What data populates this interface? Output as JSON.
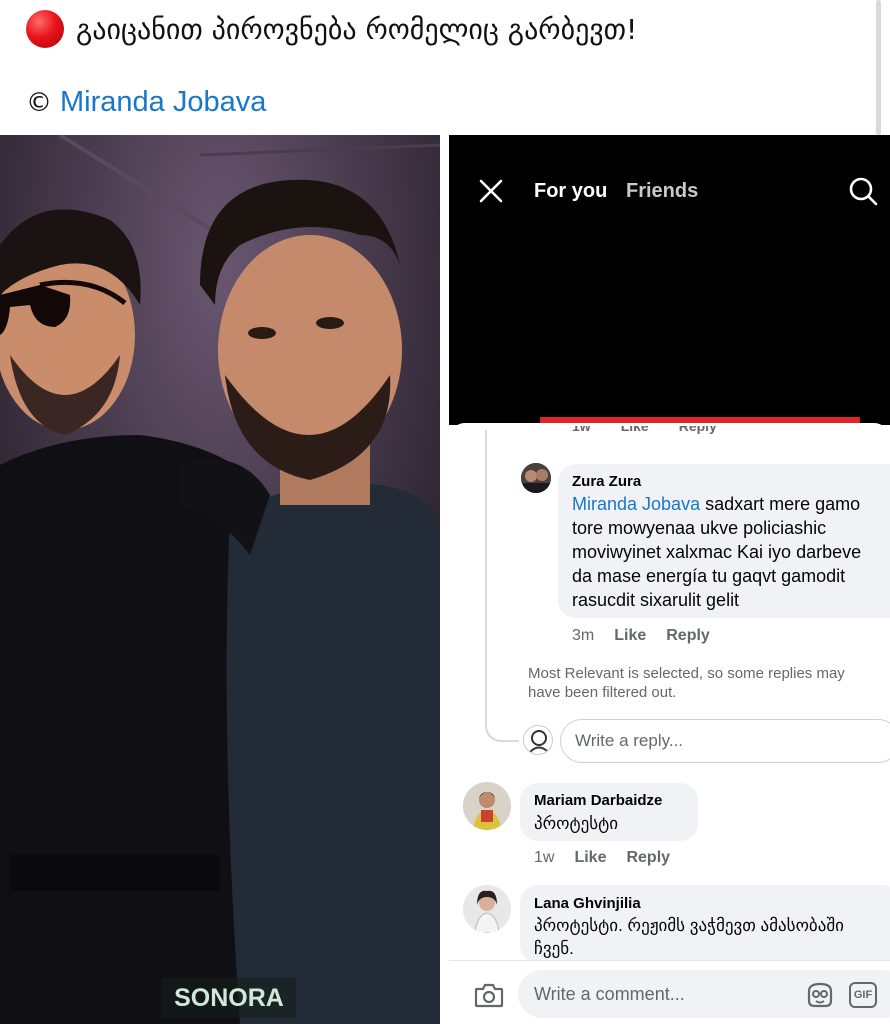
{
  "post": {
    "title": "გაიცანით პიროვნება რომელიც გარბევთ!",
    "copyright_symbol": "©",
    "author": "Miranda Jobava"
  },
  "photo": {
    "watermark": "SONORA"
  },
  "app": {
    "tabs": [
      "For you",
      "Friends"
    ],
    "icons": {
      "close": "close-icon",
      "search": "search-icon",
      "camera": "camera-icon",
      "sticker": "sticker-icon",
      "gif": "gif-icon"
    }
  },
  "comments": {
    "cut_meta": [
      "1w",
      "Like",
      "Reply"
    ],
    "zura": {
      "name": "Zura Zura",
      "mention": "Miranda Jobava",
      "text_line1": "sadxart mere gamo",
      "text_line2": "tore mowyenaa ukve policiashic",
      "text_line3": "moviwyinet xalxmac  Kai iyo darbeve",
      "text_line4": "da mase energía tu gaqvt gamodit",
      "text_line5": "rasucdit sixarulit gelit",
      "time": "3m",
      "like": "Like",
      "reply": "Reply"
    },
    "filter_note_line1": "Most Relevant is selected, so some replies may",
    "filter_note_line2": "have been filtered out.",
    "reply_placeholder": "Write a reply...",
    "mariam": {
      "name": "Mariam Darbaidze",
      "text": "პროტესტი",
      "time": "1w",
      "like": "Like",
      "reply": "Reply"
    },
    "lana": {
      "name": "Lana Ghvinjilia",
      "text_line1": "პროტესტი. რეჟიმს ვაჭმევთ ამასობაში",
      "text_line2": "ჩვენ."
    },
    "comment_placeholder": "Write a comment...",
    "gif_label": "GIF"
  },
  "colors": {
    "link": "#1877c9",
    "bubble": "#f0f2f5",
    "meta": "#65676b",
    "red_dot": "#e8141c"
  }
}
